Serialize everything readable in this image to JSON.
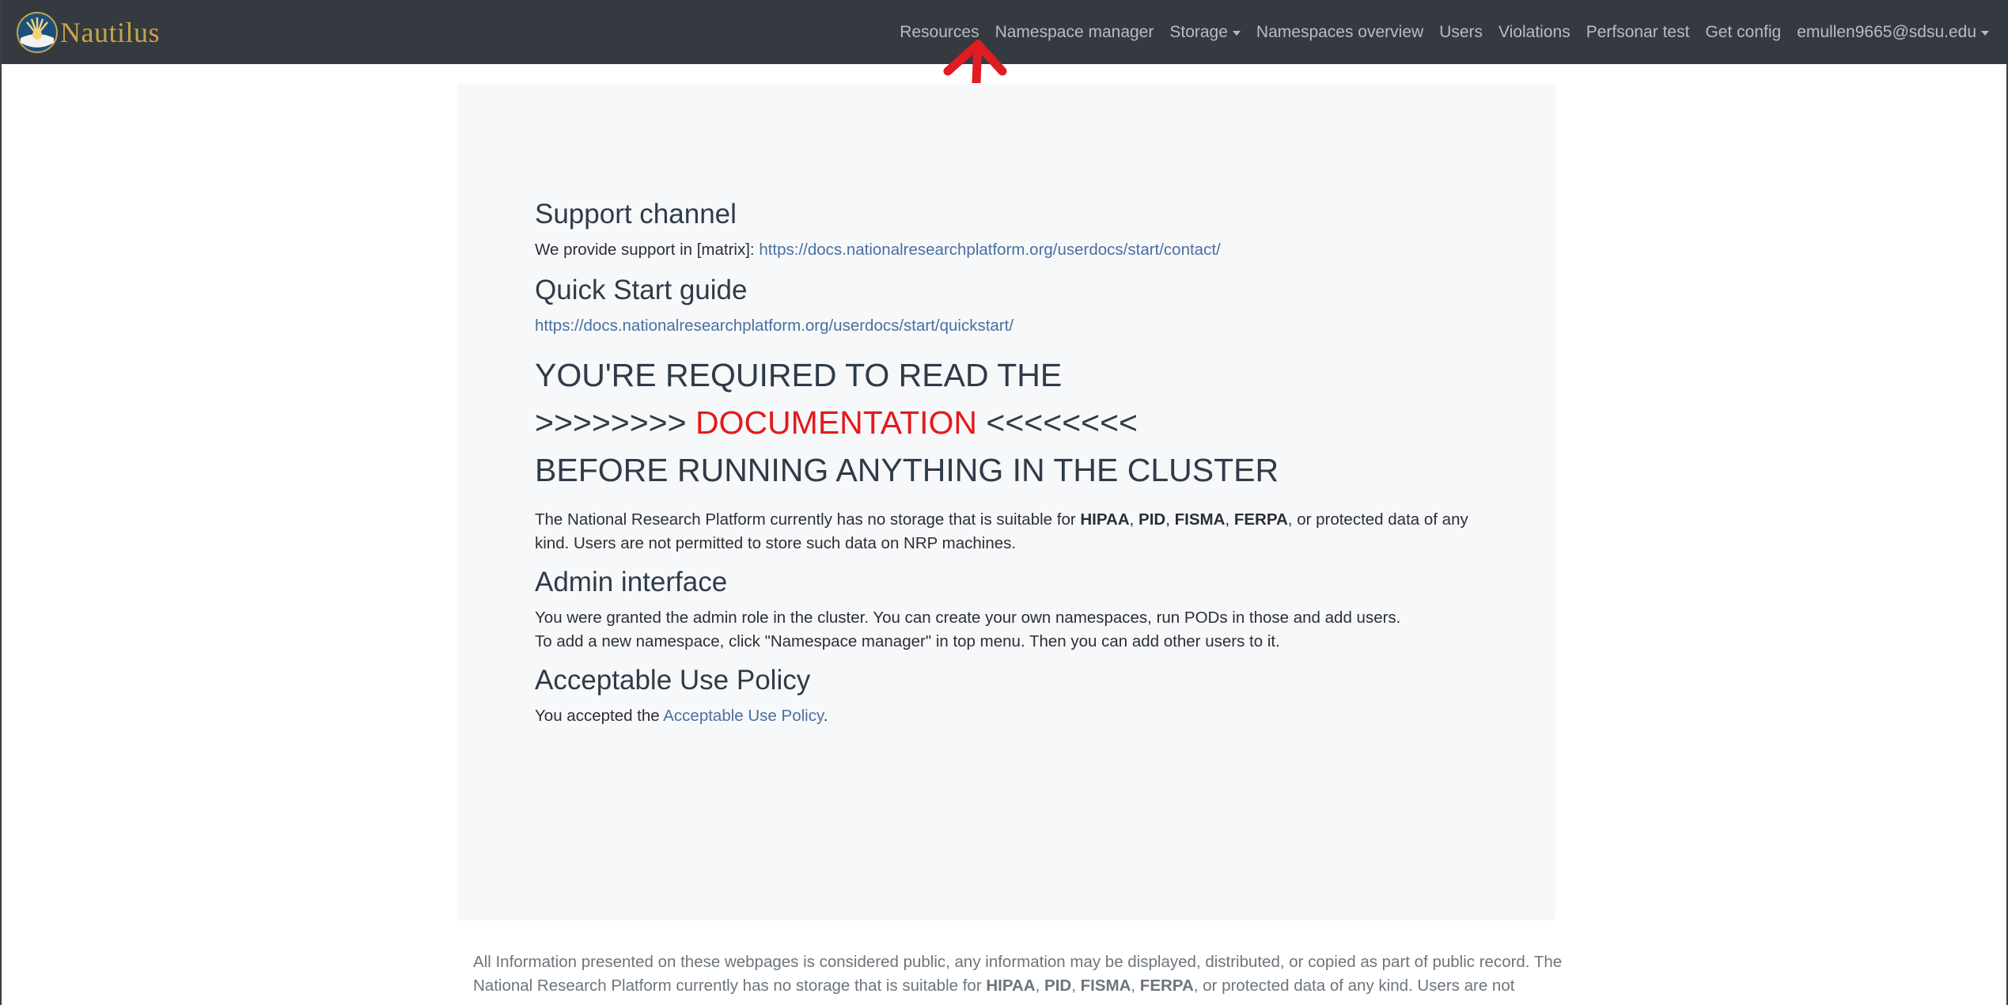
{
  "navbar": {
    "brand": "Nautilus",
    "items": [
      {
        "label": "Resources",
        "dropdown": false
      },
      {
        "label": "Namespace manager",
        "dropdown": false
      },
      {
        "label": "Storage",
        "dropdown": true
      },
      {
        "label": "Namespaces overview",
        "dropdown": false
      },
      {
        "label": "Users",
        "dropdown": false
      },
      {
        "label": "Violations",
        "dropdown": false
      },
      {
        "label": "Perfsonar test",
        "dropdown": false
      },
      {
        "label": "Get config",
        "dropdown": false
      },
      {
        "label": "emullen9665@sdsu.edu",
        "dropdown": true
      }
    ]
  },
  "support": {
    "title": "Support channel",
    "text": "We provide support in [matrix]: ",
    "link": "https://docs.nationalresearchplatform.org/userdocs/start/contact/"
  },
  "quickstart": {
    "title": "Quick Start guide",
    "link": "https://docs.nationalresearchplatform.org/userdocs/start/quickstart/"
  },
  "warning": {
    "line1": "YOU'RE REQUIRED TO READ THE",
    "line2_prefix": ">>>>>>>> ",
    "line2_highlight": "DOCUMENTATION",
    "line2_suffix": " <<<<<<<<",
    "line3": "BEFORE RUNNING ANYTHING IN THE CLUSTER"
  },
  "storage_notice": {
    "t1": "The National Research Platform currently has no storage that is suitable for ",
    "b1": "HIPAA",
    "s1": ", ",
    "b2": "PID",
    "s2": ", ",
    "b3": "FISMA",
    "s3": ", ",
    "b4": "FERPA",
    "t2": ", or protected data of any kind. Users are not permitted to store such data on NRP machines."
  },
  "admin": {
    "title": "Admin interface",
    "line1": "You were granted the admin role in the cluster. You can create your own namespaces, run PODs in those and add users.",
    "line2": "To add a new namespace, click \"Namespace manager\" in top menu. Then you can add other users to it."
  },
  "aup": {
    "title": "Acceptable Use Policy",
    "text": "You accepted the ",
    "link": "Acceptable Use Policy",
    "end": "."
  },
  "footer": {
    "t1": "All Information presented on these webpages is considered public, any information may be displayed, distributed, or copied as part of public record. The National Research Platform currently has no storage that is suitable for ",
    "b1": "HIPAA",
    "s1": ", ",
    "b2": "PID",
    "s2": ", ",
    "b3": "FISMA",
    "s3": ", ",
    "b4": "FERPA",
    "t2": ", or protected data of any kind. Users are not"
  },
  "colors": {
    "navbar": "#343a40",
    "brand": "#c9a24a",
    "link": "#4a6fa0",
    "highlight": "#e31a1c",
    "annotation_arrow": "#e11b22"
  }
}
